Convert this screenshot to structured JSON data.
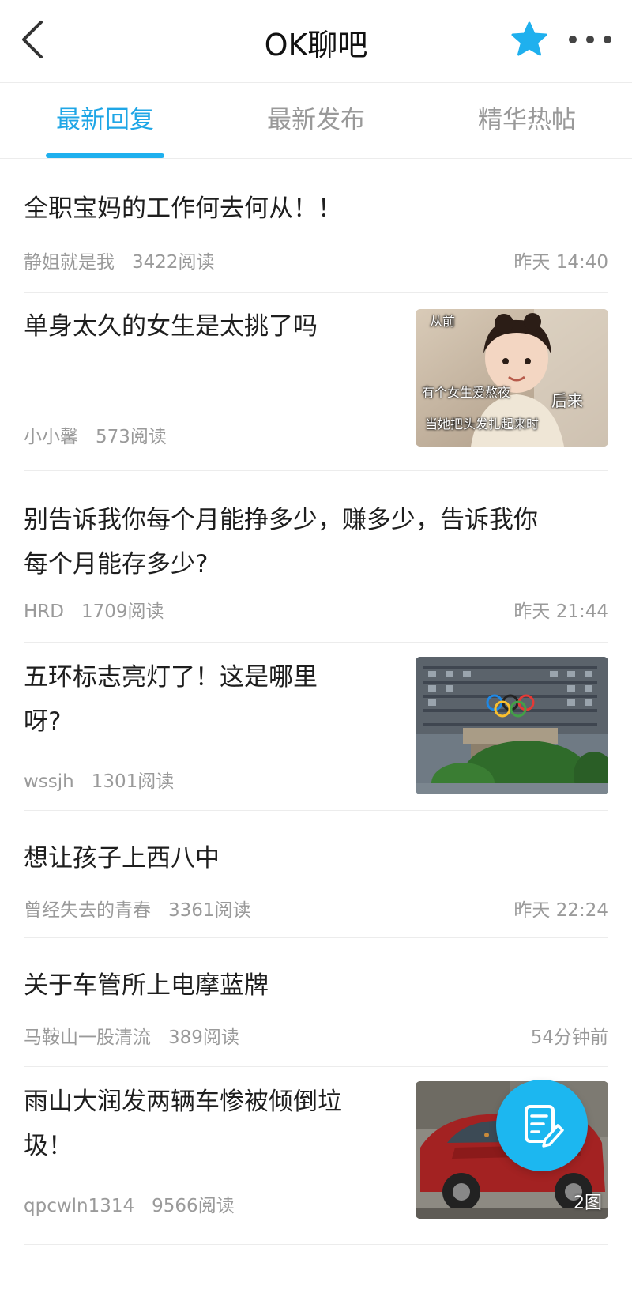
{
  "header": {
    "title": "OK聊吧",
    "back_icon": "chevron-left-icon",
    "favorite_icon": "star-icon",
    "more_icon": "more-horizontal-icon",
    "favorite_color": "#1fb0ee"
  },
  "tabs": [
    {
      "label": "最新回复",
      "active": true
    },
    {
      "label": "最新发布",
      "active": false
    },
    {
      "label": "精华热帖",
      "active": false
    }
  ],
  "accent_color": "#1fa6e6",
  "posts": [
    {
      "title": "全职宝妈的工作何去何从！！",
      "author": "静姐就是我",
      "reads": "3422阅读",
      "time": "昨天 14:40"
    },
    {
      "title": "单身太久的女生是太挑了吗",
      "author": "小小馨",
      "reads": "573阅读",
      "thumb_captions": [
        "从前",
        "有个女生爱熬夜",
        "后来",
        "当她把头发扎起来时"
      ]
    },
    {
      "title_lines": [
        "别告诉我你每个月能挣多少，赚多少，告诉我你",
        "每个月能存多少?"
      ],
      "author": "HRD",
      "reads": "1709阅读",
      "time": "昨天 21:44"
    },
    {
      "title_lines": [
        "五环标志亮灯了！这是哪里",
        "呀?"
      ],
      "author": "wssjh",
      "reads": "1301阅读"
    },
    {
      "title": "想让孩子上西八中",
      "author": "曾经失去的青春",
      "reads": "3361阅读",
      "time": "昨天 22:24"
    },
    {
      "title": "关于车管所上电摩蓝牌",
      "author": "马鞍山一股清流",
      "reads": "389阅读",
      "time": "54分钟前"
    },
    {
      "title_lines": [
        "雨山大润发两辆车惨被倾倒垃",
        "圾！"
      ],
      "author": "qpcwln1314",
      "reads": "9566阅读",
      "image_count": "2图"
    }
  ],
  "fab": {
    "icon": "compose-edit-icon"
  }
}
